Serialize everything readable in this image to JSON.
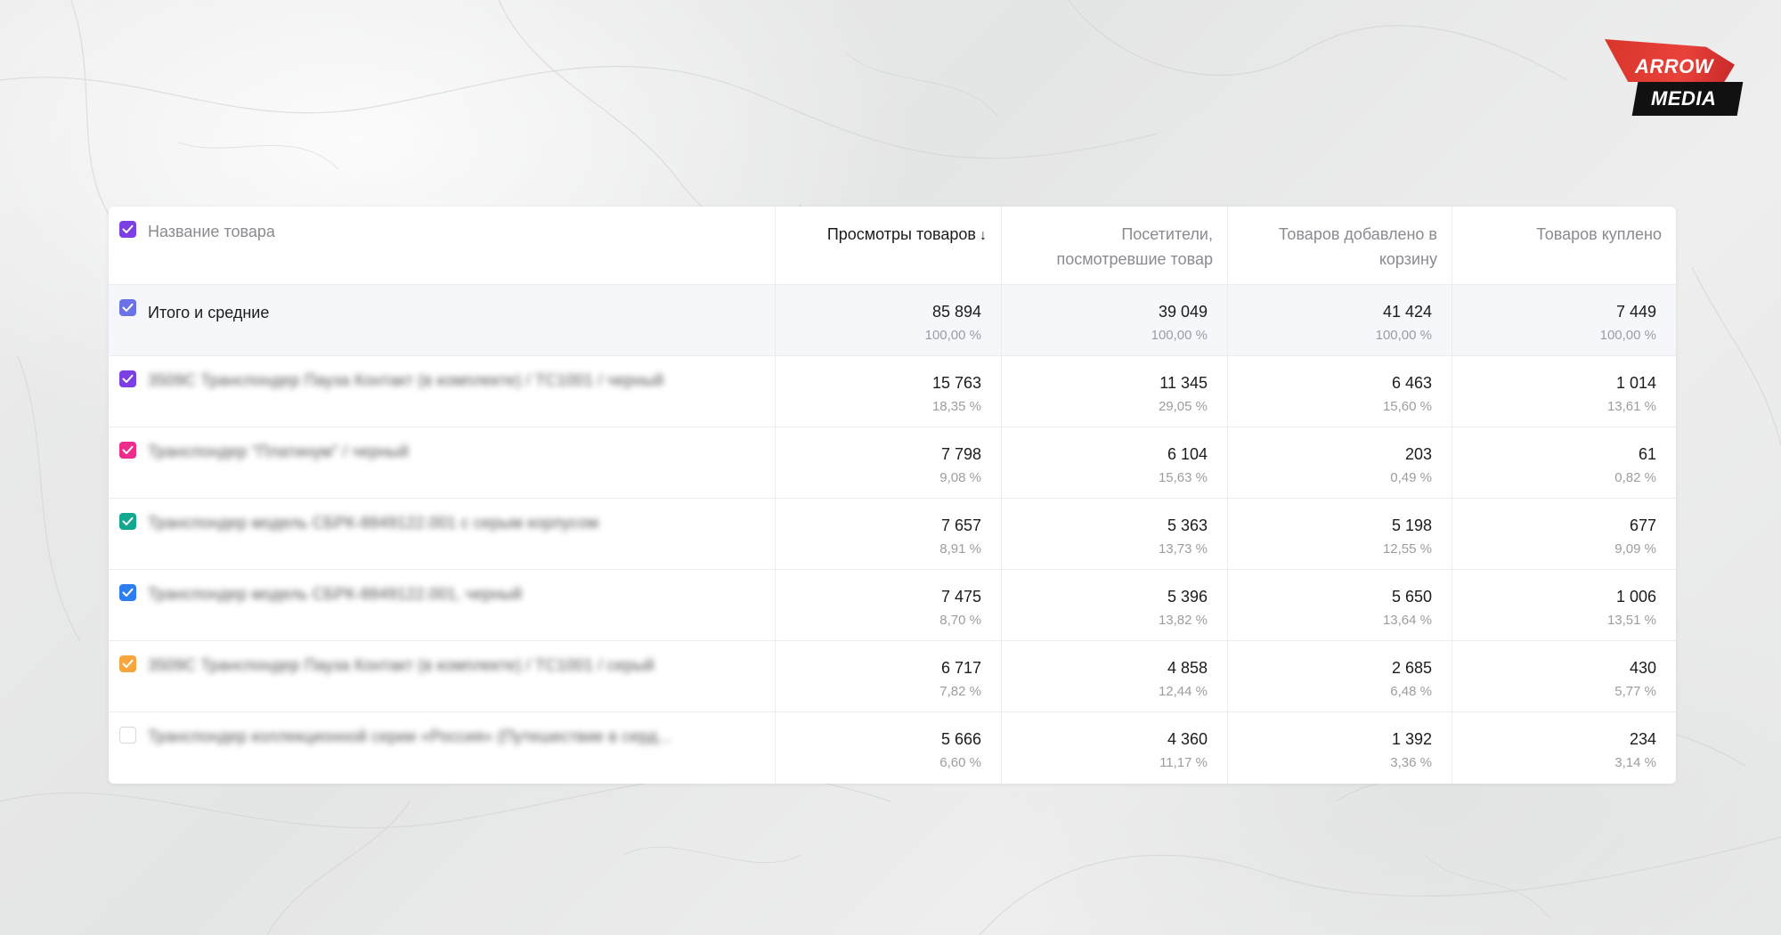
{
  "logo": {
    "line1": "ARROW",
    "line2": "MEDIA"
  },
  "colors": {
    "purple": "#7b3fe4",
    "pink": "#ee2c8c",
    "teal": "#12a88f",
    "blue": "#2d7ef0",
    "orange": "#f6a63c",
    "total_check": "#6b72e6"
  },
  "table": {
    "columns": {
      "name": "Название товара",
      "views": "Просмотры товаров",
      "sort_indicator": "↓",
      "visitors_line1": "Посетители,",
      "visitors_line2": "посмотревшие товар",
      "added_line1": "Товаров добавлено в",
      "added_line2": "корзину",
      "bought": "Товаров куплено"
    },
    "total": {
      "label": "Итого и средние",
      "views": "85 894",
      "views_pct": "100,00 %",
      "visitors": "39 049",
      "visitors_pct": "100,00 %",
      "added": "41 424",
      "added_pct": "100,00 %",
      "bought": "7 449",
      "bought_pct": "100,00 %"
    },
    "rows": [
      {
        "name": "3509С Транспондер Пауза Контакт (в комплекте) / TC1001 / черный",
        "views": "15 763",
        "views_pct": "18,35 %",
        "visitors": "11 345",
        "visitors_pct": "29,05 %",
        "added": "6 463",
        "added_pct": "15,60 %",
        "bought": "1 014",
        "bought_pct": "13,61 %"
      },
      {
        "name": "Транспондер \"Платинум\" / черный",
        "views": "7 798",
        "views_pct": "9,08 %",
        "visitors": "6 104",
        "visitors_pct": "15,63 %",
        "added": "203",
        "added_pct": "0,49 %",
        "bought": "61",
        "bought_pct": "0,82 %"
      },
      {
        "name": "Транспондер модель СБРК-8849122.001 с серым корпусом",
        "views": "7 657",
        "views_pct": "8,91 %",
        "visitors": "5 363",
        "visitors_pct": "13,73 %",
        "added": "5 198",
        "added_pct": "12,55 %",
        "bought": "677",
        "bought_pct": "9,09 %"
      },
      {
        "name": "Транспондер модель СБРК-8849122.001, черный",
        "views": "7 475",
        "views_pct": "8,70 %",
        "visitors": "5 396",
        "visitors_pct": "13,82 %",
        "added": "5 650",
        "added_pct": "13,64 %",
        "bought": "1 006",
        "bought_pct": "13,51 %"
      },
      {
        "name": "3509С Транспондер Пауза Контакт (в комплекте) / TC1001 / серый",
        "views": "6 717",
        "views_pct": "7,82 %",
        "visitors": "4 858",
        "visitors_pct": "12,44 %",
        "added": "2 685",
        "added_pct": "6,48 %",
        "bought": "430",
        "bought_pct": "5,77 %"
      },
      {
        "name": "Транспондер коллекционной серии «Россия» (Путешествие в серд...",
        "views": "5 666",
        "views_pct": "6,60 %",
        "visitors": "4 360",
        "visitors_pct": "11,17 %",
        "added": "1 392",
        "added_pct": "3,36 %",
        "bought": "234",
        "bought_pct": "3,14 %"
      }
    ]
  }
}
